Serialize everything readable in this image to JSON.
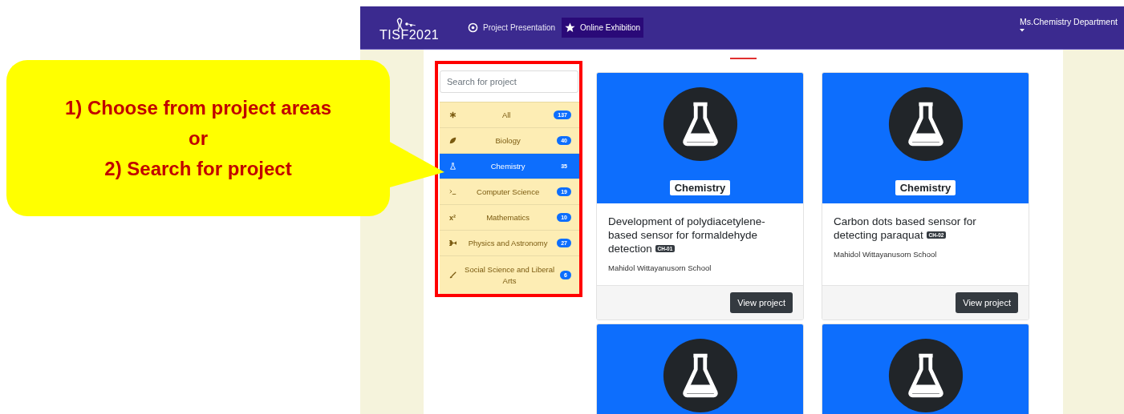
{
  "callout": {
    "lines": [
      "1) Choose from project areas",
      "or",
      "2) Search for project"
    ]
  },
  "navbar": {
    "logo": "TISF2021",
    "items": [
      {
        "label": "Project Presentation",
        "selected": false
      },
      {
        "label": "Online Exhibition",
        "selected": true
      }
    ],
    "user": "Ms.Chemistry Department"
  },
  "sidebar": {
    "search": {
      "placeholder": "Search for project"
    },
    "categories": [
      {
        "label": "All",
        "count": "137",
        "selected": false
      },
      {
        "label": "Biology",
        "count": "40",
        "selected": false
      },
      {
        "label": "Chemistry",
        "count": "35",
        "selected": true
      },
      {
        "label": "Computer Science",
        "count": "19",
        "selected": false
      },
      {
        "label": "Mathematics",
        "count": "10",
        "selected": false,
        "symbol": "x²"
      },
      {
        "label": "Physics and Astronomy",
        "count": "27",
        "selected": false
      },
      {
        "label": "Social Science and Liberal Arts",
        "count": "6",
        "selected": false
      }
    ]
  },
  "cards": [
    {
      "kind": "full",
      "category": "Chemistry",
      "title": "Development of polydiacetylene-based sensor for formaldehyde detection",
      "code": "CH-01",
      "school": "Mahidol Wittayanusorn School",
      "button": "View project"
    },
    {
      "kind": "full",
      "category": "Chemistry",
      "title": "Carbon dots based sensor for detecting paraquat",
      "code": "CH-02",
      "school": "Mahidol Wittayanusorn School",
      "button": "View project"
    },
    {
      "kind": "cut"
    },
    {
      "kind": "cut"
    }
  ]
}
